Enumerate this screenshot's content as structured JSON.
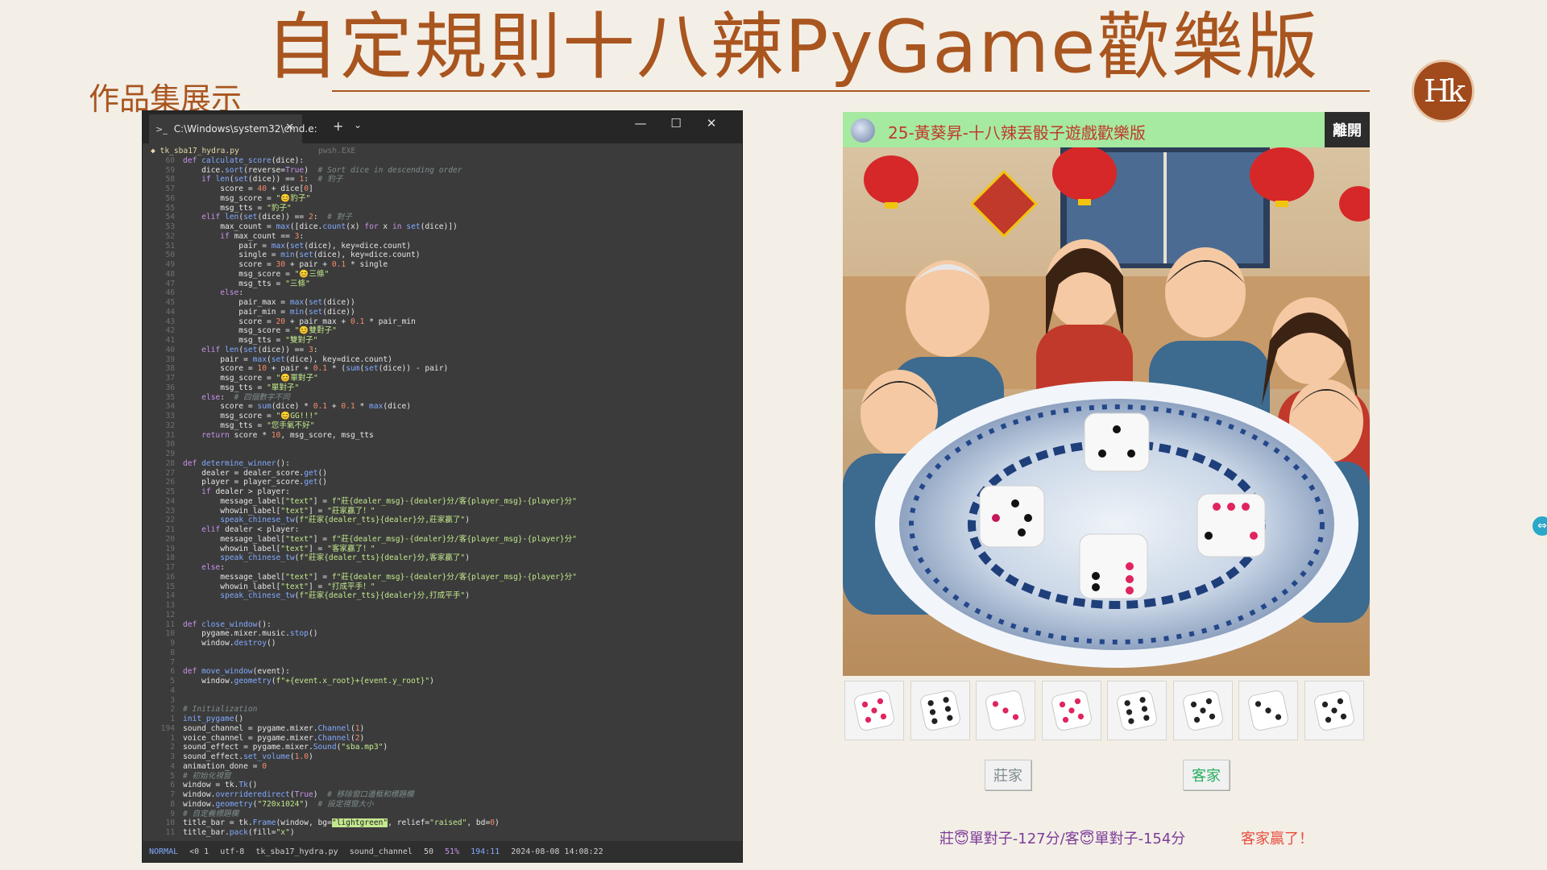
{
  "slide": {
    "title": "自定規則十八辣PyGame歡樂版",
    "subtitle": "作品集展示",
    "logo_text": "Hk",
    "edge_handle_icon": "arrows-horizontal-icon"
  },
  "terminal": {
    "tab_title": "C:\\Windows\\system32\\cmd.e:",
    "tab_icon": "terminal-icon",
    "new_tab_icon": "plus-icon",
    "dropdown_icon": "chevron-down-icon",
    "window_buttons": {
      "minimize": "—",
      "maximize": "☐",
      "close": "✕"
    },
    "file_header": "◆ tk_sba17_hydra.py",
    "file_header_right": "pwsh.EXE",
    "statusline": {
      "mode": "NORMAL",
      "mark": "<0 1",
      "encoding": "utf-8",
      "file": "tk_sba17_hydra.py",
      "symbol": "sound_channel",
      "count": "50",
      "percent": "51%",
      "position": "194:11",
      "datetime": "2024-08-08 14:08:22"
    }
  },
  "game": {
    "window_title": "25-黃葵昇-十八辣丟骰子遊戲歡樂版",
    "leave_button": "離開",
    "scene_description_icon": "family-dice-party-illustration",
    "dice": [
      {
        "pips": 5,
        "pip_color": "#e0245e"
      },
      {
        "pips": 6,
        "pip_color": "#222222"
      },
      {
        "pips": 3,
        "pip_color": "#e0245e"
      },
      {
        "pips": 5,
        "pip_color": "#e0245e"
      },
      {
        "pips": 6,
        "pip_color": "#222222"
      },
      {
        "pips": 5,
        "pip_color": "#222222"
      },
      {
        "pips": 3,
        "pip_color": "#222222"
      },
      {
        "pips": 5,
        "pip_color": "#222222"
      }
    ],
    "dealer_button": "莊家",
    "player_button": "客家",
    "dealer_color": "#7f8c8d",
    "player_color": "#27ae60",
    "message": "莊😇單對子-127分/客😇單對子-154分",
    "winner": "客家贏了！"
  }
}
